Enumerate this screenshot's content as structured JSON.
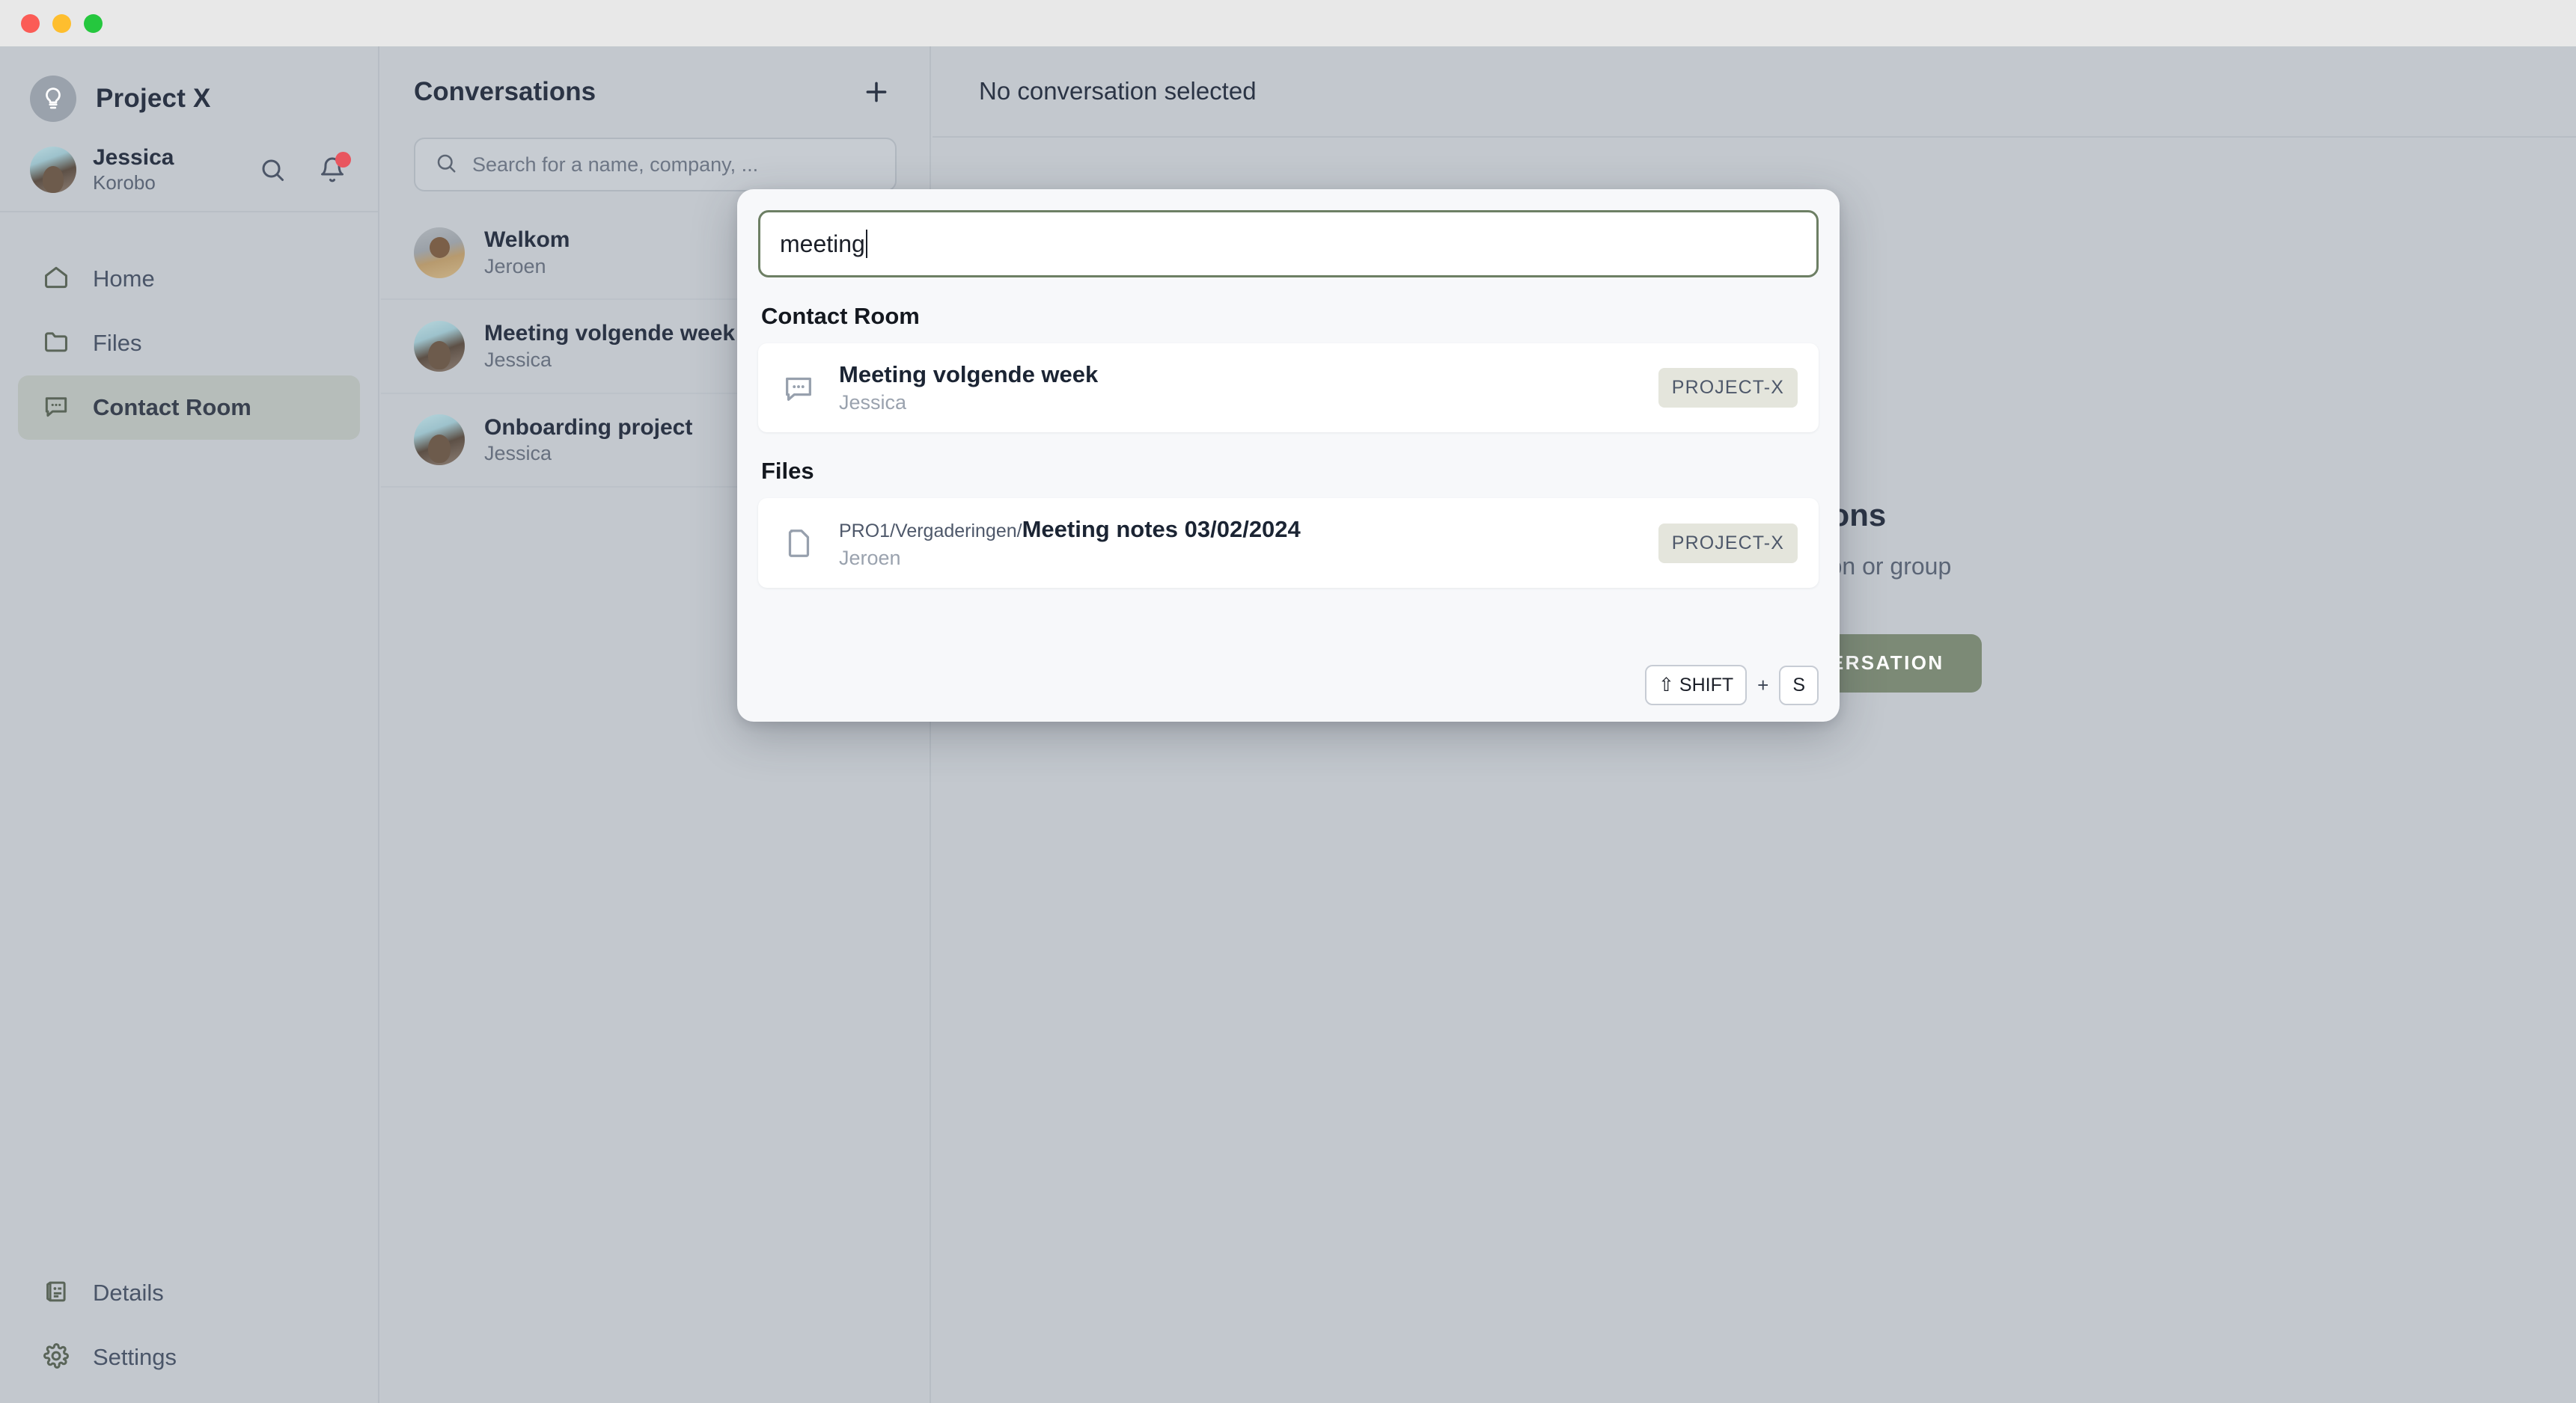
{
  "window": {
    "traffic_lights": [
      {
        "name": "close",
        "color": "#fb5c56"
      },
      {
        "name": "minimize",
        "color": "#febe2e"
      },
      {
        "name": "maximize",
        "color": "#25c73e"
      }
    ]
  },
  "sidebar": {
    "brand": {
      "title": "Project X",
      "logo_icon": "lightbulb-icon"
    },
    "user": {
      "name": "Jessica",
      "company": "Korobo",
      "avatar_icon": "avatar"
    },
    "user_actions": [
      {
        "name": "search-icon",
        "label": "Search"
      },
      {
        "name": "bell-icon",
        "label": "Notifications",
        "has_unread_dot": true
      }
    ],
    "nav_items": [
      {
        "label": "Home",
        "icon": "home-icon",
        "active": false
      },
      {
        "label": "Files",
        "icon": "folder-icon",
        "active": false
      },
      {
        "label": "Contact Room",
        "icon": "chat-bubble-icon",
        "active": true
      }
    ],
    "nav_bottom_items": [
      {
        "label": "Details",
        "icon": "document-icon",
        "active": false
      },
      {
        "label": "Settings",
        "icon": "gear-icon",
        "active": false
      }
    ]
  },
  "conversations": {
    "title": "Conversations",
    "add_button_icon": "plus-icon",
    "search_placeholder": "Search for a name, company, ...",
    "search_value": "",
    "search_icon": "search-icon",
    "items": [
      {
        "title": "Welkom",
        "sender": "Jeroen",
        "avatar": "male"
      },
      {
        "title": "Meeting volgende week",
        "sender": "Jessica",
        "avatar": "female"
      },
      {
        "title": "Onboarding project",
        "sender": "Jessica",
        "avatar": "female"
      }
    ]
  },
  "main": {
    "header_title": "No conversation selected",
    "empty_title": "No conversations",
    "empty_subtitle": "Send messages to a person or group",
    "start_button_label": "START A NEW CONVERSATION",
    "start_button_icon": "plus-icon",
    "start_button_color": "#7c8a76"
  },
  "search_modal": {
    "input_value": "meeting",
    "input_border_color": "#6d7f64",
    "groups": [
      {
        "title": "Contact Room",
        "results": [
          {
            "icon": "chat-bubble-icon",
            "path_prefix": "",
            "title": "Meeting volgende week",
            "subtitle": "Jessica",
            "badge": "PROJECT-X"
          }
        ]
      },
      {
        "title": "Files",
        "results": [
          {
            "icon": "file-icon",
            "path_prefix": "PRO1/Vergaderingen/",
            "title": "Meeting notes 03/02/2024",
            "subtitle": "Jeroen",
            "badge": "PROJECT-X"
          }
        ]
      }
    ],
    "shortcut": {
      "modifier": "⇧ SHIFT",
      "plus": "+",
      "key": "S"
    }
  }
}
